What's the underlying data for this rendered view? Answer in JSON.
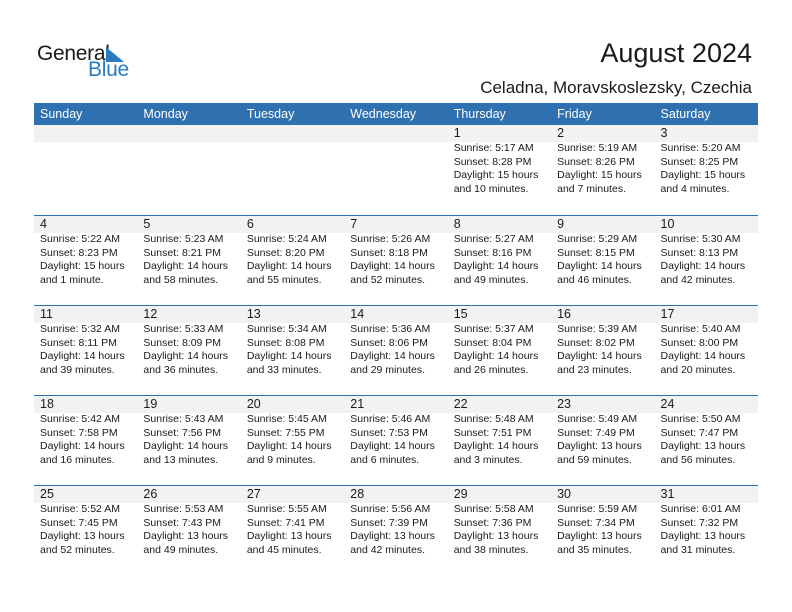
{
  "logo": {
    "general": "General",
    "blue": "Blue"
  },
  "header": {
    "title": "August 2024",
    "location": "Celadna, Moravskoslezsky, Czechia"
  },
  "weekdays": [
    "Sunday",
    "Monday",
    "Tuesday",
    "Wednesday",
    "Thursday",
    "Friday",
    "Saturday"
  ],
  "weeks": [
    [
      null,
      null,
      null,
      null,
      {
        "day": "1",
        "sunrise": "Sunrise: 5:17 AM",
        "sunset": "Sunset: 8:28 PM",
        "daylight1": "Daylight: 15 hours",
        "daylight2": "and 10 minutes."
      },
      {
        "day": "2",
        "sunrise": "Sunrise: 5:19 AM",
        "sunset": "Sunset: 8:26 PM",
        "daylight1": "Daylight: 15 hours",
        "daylight2": "and 7 minutes."
      },
      {
        "day": "3",
        "sunrise": "Sunrise: 5:20 AM",
        "sunset": "Sunset: 8:25 PM",
        "daylight1": "Daylight: 15 hours",
        "daylight2": "and 4 minutes."
      }
    ],
    [
      {
        "day": "4",
        "sunrise": "Sunrise: 5:22 AM",
        "sunset": "Sunset: 8:23 PM",
        "daylight1": "Daylight: 15 hours",
        "daylight2": "and 1 minute."
      },
      {
        "day": "5",
        "sunrise": "Sunrise: 5:23 AM",
        "sunset": "Sunset: 8:21 PM",
        "daylight1": "Daylight: 14 hours",
        "daylight2": "and 58 minutes."
      },
      {
        "day": "6",
        "sunrise": "Sunrise: 5:24 AM",
        "sunset": "Sunset: 8:20 PM",
        "daylight1": "Daylight: 14 hours",
        "daylight2": "and 55 minutes."
      },
      {
        "day": "7",
        "sunrise": "Sunrise: 5:26 AM",
        "sunset": "Sunset: 8:18 PM",
        "daylight1": "Daylight: 14 hours",
        "daylight2": "and 52 minutes."
      },
      {
        "day": "8",
        "sunrise": "Sunrise: 5:27 AM",
        "sunset": "Sunset: 8:16 PM",
        "daylight1": "Daylight: 14 hours",
        "daylight2": "and 49 minutes."
      },
      {
        "day": "9",
        "sunrise": "Sunrise: 5:29 AM",
        "sunset": "Sunset: 8:15 PM",
        "daylight1": "Daylight: 14 hours",
        "daylight2": "and 46 minutes."
      },
      {
        "day": "10",
        "sunrise": "Sunrise: 5:30 AM",
        "sunset": "Sunset: 8:13 PM",
        "daylight1": "Daylight: 14 hours",
        "daylight2": "and 42 minutes."
      }
    ],
    [
      {
        "day": "11",
        "sunrise": "Sunrise: 5:32 AM",
        "sunset": "Sunset: 8:11 PM",
        "daylight1": "Daylight: 14 hours",
        "daylight2": "and 39 minutes."
      },
      {
        "day": "12",
        "sunrise": "Sunrise: 5:33 AM",
        "sunset": "Sunset: 8:09 PM",
        "daylight1": "Daylight: 14 hours",
        "daylight2": "and 36 minutes."
      },
      {
        "day": "13",
        "sunrise": "Sunrise: 5:34 AM",
        "sunset": "Sunset: 8:08 PM",
        "daylight1": "Daylight: 14 hours",
        "daylight2": "and 33 minutes."
      },
      {
        "day": "14",
        "sunrise": "Sunrise: 5:36 AM",
        "sunset": "Sunset: 8:06 PM",
        "daylight1": "Daylight: 14 hours",
        "daylight2": "and 29 minutes."
      },
      {
        "day": "15",
        "sunrise": "Sunrise: 5:37 AM",
        "sunset": "Sunset: 8:04 PM",
        "daylight1": "Daylight: 14 hours",
        "daylight2": "and 26 minutes."
      },
      {
        "day": "16",
        "sunrise": "Sunrise: 5:39 AM",
        "sunset": "Sunset: 8:02 PM",
        "daylight1": "Daylight: 14 hours",
        "daylight2": "and 23 minutes."
      },
      {
        "day": "17",
        "sunrise": "Sunrise: 5:40 AM",
        "sunset": "Sunset: 8:00 PM",
        "daylight1": "Daylight: 14 hours",
        "daylight2": "and 20 minutes."
      }
    ],
    [
      {
        "day": "18",
        "sunrise": "Sunrise: 5:42 AM",
        "sunset": "Sunset: 7:58 PM",
        "daylight1": "Daylight: 14 hours",
        "daylight2": "and 16 minutes."
      },
      {
        "day": "19",
        "sunrise": "Sunrise: 5:43 AM",
        "sunset": "Sunset: 7:56 PM",
        "daylight1": "Daylight: 14 hours",
        "daylight2": "and 13 minutes."
      },
      {
        "day": "20",
        "sunrise": "Sunrise: 5:45 AM",
        "sunset": "Sunset: 7:55 PM",
        "daylight1": "Daylight: 14 hours",
        "daylight2": "and 9 minutes."
      },
      {
        "day": "21",
        "sunrise": "Sunrise: 5:46 AM",
        "sunset": "Sunset: 7:53 PM",
        "daylight1": "Daylight: 14 hours",
        "daylight2": "and 6 minutes."
      },
      {
        "day": "22",
        "sunrise": "Sunrise: 5:48 AM",
        "sunset": "Sunset: 7:51 PM",
        "daylight1": "Daylight: 14 hours",
        "daylight2": "and 3 minutes."
      },
      {
        "day": "23",
        "sunrise": "Sunrise: 5:49 AM",
        "sunset": "Sunset: 7:49 PM",
        "daylight1": "Daylight: 13 hours",
        "daylight2": "and 59 minutes."
      },
      {
        "day": "24",
        "sunrise": "Sunrise: 5:50 AM",
        "sunset": "Sunset: 7:47 PM",
        "daylight1": "Daylight: 13 hours",
        "daylight2": "and 56 minutes."
      }
    ],
    [
      {
        "day": "25",
        "sunrise": "Sunrise: 5:52 AM",
        "sunset": "Sunset: 7:45 PM",
        "daylight1": "Daylight: 13 hours",
        "daylight2": "and 52 minutes."
      },
      {
        "day": "26",
        "sunrise": "Sunrise: 5:53 AM",
        "sunset": "Sunset: 7:43 PM",
        "daylight1": "Daylight: 13 hours",
        "daylight2": "and 49 minutes."
      },
      {
        "day": "27",
        "sunrise": "Sunrise: 5:55 AM",
        "sunset": "Sunset: 7:41 PM",
        "daylight1": "Daylight: 13 hours",
        "daylight2": "and 45 minutes."
      },
      {
        "day": "28",
        "sunrise": "Sunrise: 5:56 AM",
        "sunset": "Sunset: 7:39 PM",
        "daylight1": "Daylight: 13 hours",
        "daylight2": "and 42 minutes."
      },
      {
        "day": "29",
        "sunrise": "Sunrise: 5:58 AM",
        "sunset": "Sunset: 7:36 PM",
        "daylight1": "Daylight: 13 hours",
        "daylight2": "and 38 minutes."
      },
      {
        "day": "30",
        "sunrise": "Sunrise: 5:59 AM",
        "sunset": "Sunset: 7:34 PM",
        "daylight1": "Daylight: 13 hours",
        "daylight2": "and 35 minutes."
      },
      {
        "day": "31",
        "sunrise": "Sunrise: 6:01 AM",
        "sunset": "Sunset: 7:32 PM",
        "daylight1": "Daylight: 13 hours",
        "daylight2": "and 31 minutes."
      }
    ]
  ],
  "colors": {
    "accent": "#2e70b0",
    "logo_blue": "#2a7ac0",
    "date_strip": "#f2f2f2"
  }
}
